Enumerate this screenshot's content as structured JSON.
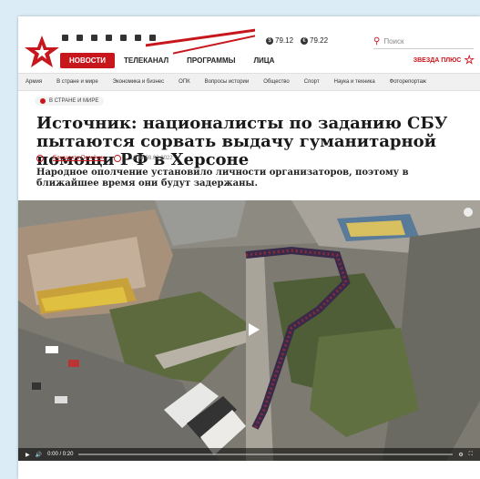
{
  "header": {
    "social_icons": [
      "vk-icon",
      "ok-icon",
      "twitter-icon",
      "telegram-icon",
      "zen-icon",
      "tiktok-icon",
      "rss-icon"
    ],
    "nav": [
      {
        "label": "НОВОСТИ",
        "active": true
      },
      {
        "label": "ТЕЛЕКАНАЛ",
        "active": false
      },
      {
        "label": "ПРОГРАММЫ",
        "active": false
      },
      {
        "label": "ЛИЦА",
        "active": false
      }
    ],
    "rates": [
      {
        "symbol": "$",
        "value": "79.12"
      },
      {
        "symbol": "€",
        "value": "79.22"
      }
    ],
    "search_placeholder": "Поиск",
    "brand": "ЗВЕЗДА ПЛЮС",
    "accent": "#c8161d"
  },
  "categories": [
    "Армия",
    "В стране и мире",
    "Экономика и бизнес",
    "ОПК",
    "Вопросы истории",
    "Общество",
    "Спорт",
    "Наука и техника",
    "Фоторепортаж"
  ],
  "article": {
    "section": "В СТРАНЕ И МИРЕ",
    "title": "Источник: националисты по заданию СБУ пытаются сорвать выдачу гуманитарной помощи РФ в Херсоне",
    "author": "Елизавета Потейчик",
    "date": "10:34 08.03.2022",
    "lead": "Народное ополчение установило личности организаторов, поэтому в ближайшее время они будут задержаны."
  },
  "video": {
    "time": "0:00 / 0:20"
  }
}
